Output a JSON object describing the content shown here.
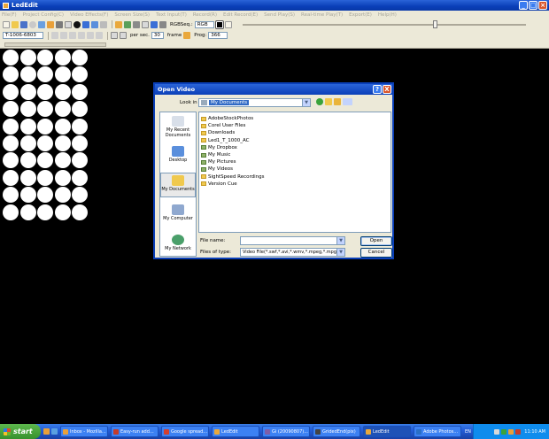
{
  "window": {
    "title": "LedEdit"
  },
  "menu": [
    "File(F)",
    "Project Config(C)",
    "Video Effects(F)",
    "Screen Size(S)",
    "Text Input(T)",
    "Record(R)",
    "Edit Record(E)",
    "Send Play(S)",
    "Real-time Play(T)",
    "Export(E)",
    "Help(H)"
  ],
  "toolbar": {
    "color_label": "RGBSeq.:",
    "color_value": "RGB",
    "device_id": "T-1006-6803",
    "per_sec_label": "per sec.",
    "per_sec_value": "30",
    "frame_label": "frame",
    "prog_label": "Prog:",
    "prog_value": "366"
  },
  "led_grid": {
    "rows": 10,
    "cols": 5,
    "color": "#ffffff"
  },
  "dialog": {
    "title": "Open Video",
    "help_button": "?",
    "close_button": "X",
    "look_in_label": "Look in",
    "look_in_value": "My Documents",
    "places": [
      {
        "label": "My Recent Documents",
        "icon": "recent-documents-icon"
      },
      {
        "label": "Desktop",
        "icon": "desktop-icon"
      },
      {
        "label": "My Documents",
        "icon": "my-documents-icon"
      },
      {
        "label": "My Computer",
        "icon": "my-computer-icon"
      },
      {
        "label": "My Network",
        "icon": "my-network-icon"
      }
    ],
    "files": [
      {
        "name": "AdobeStockPhotos",
        "special": false
      },
      {
        "name": "Corel User Files",
        "special": false
      },
      {
        "name": "Downloads",
        "special": false
      },
      {
        "name": "Led1_T_1000_AC",
        "special": false
      },
      {
        "name": "My Dropbox",
        "special": true
      },
      {
        "name": "My Music",
        "special": true
      },
      {
        "name": "My Pictures",
        "special": true
      },
      {
        "name": "My Videos",
        "special": true
      },
      {
        "name": "SightSpeed Recordings",
        "special": false
      },
      {
        "name": "Version Cue",
        "special": false
      }
    ],
    "file_name_label": "File name:",
    "file_name_value": "",
    "files_of_type_label": "Files of type:",
    "files_of_type_value": "Video File(*.swf,*.avi,*.wmv,*.mpeg,*.mpg)",
    "open_button": "Open",
    "cancel_button": "Cancel"
  },
  "taskbar": {
    "start_label": "start",
    "tasks": [
      {
        "label": "Inbox - Mozilla...",
        "color": "#e8a03a"
      },
      {
        "label": "Easy-run add...",
        "color": "#c53b2a"
      },
      {
        "label": "Google spread...",
        "color": "#d33f2f"
      },
      {
        "label": "LedEdit",
        "color": "#e9a83c"
      },
      {
        "label": "Gi (20090807)...",
        "color": "#7f5ea8"
      },
      {
        "label": "GridedEnd(pix)",
        "color": "#444444"
      },
      {
        "label": "LedEdit",
        "color": "#e9a83c",
        "active": true
      },
      {
        "label": "Adobe Photos...",
        "color": "#2a6fc6"
      }
    ],
    "tray_lang": "EN",
    "clock": "11:10 AM"
  }
}
